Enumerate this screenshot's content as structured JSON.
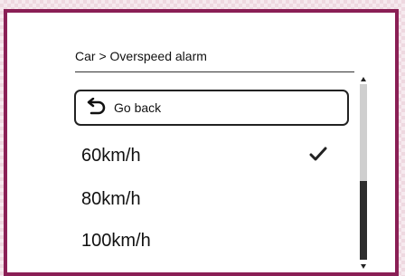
{
  "breadcrumb": "Car > Overspeed alarm",
  "go_back": {
    "label": "Go back",
    "icon": "undo-arrow-icon"
  },
  "options": [
    {
      "label": "60km/h",
      "selected": true
    },
    {
      "label": "80km/h",
      "selected": false
    },
    {
      "label": "100km/h",
      "selected": false
    }
  ],
  "check_icon": "checkmark-icon",
  "scroll": {
    "thumb_start_fraction": 0.55,
    "thumb_end_fraction": 1.0
  },
  "colors": {
    "frame_border": "#8a1f55",
    "text": "#111111",
    "scroll_track": "#cfcfcf",
    "scroll_thumb": "#2d2d2d"
  }
}
